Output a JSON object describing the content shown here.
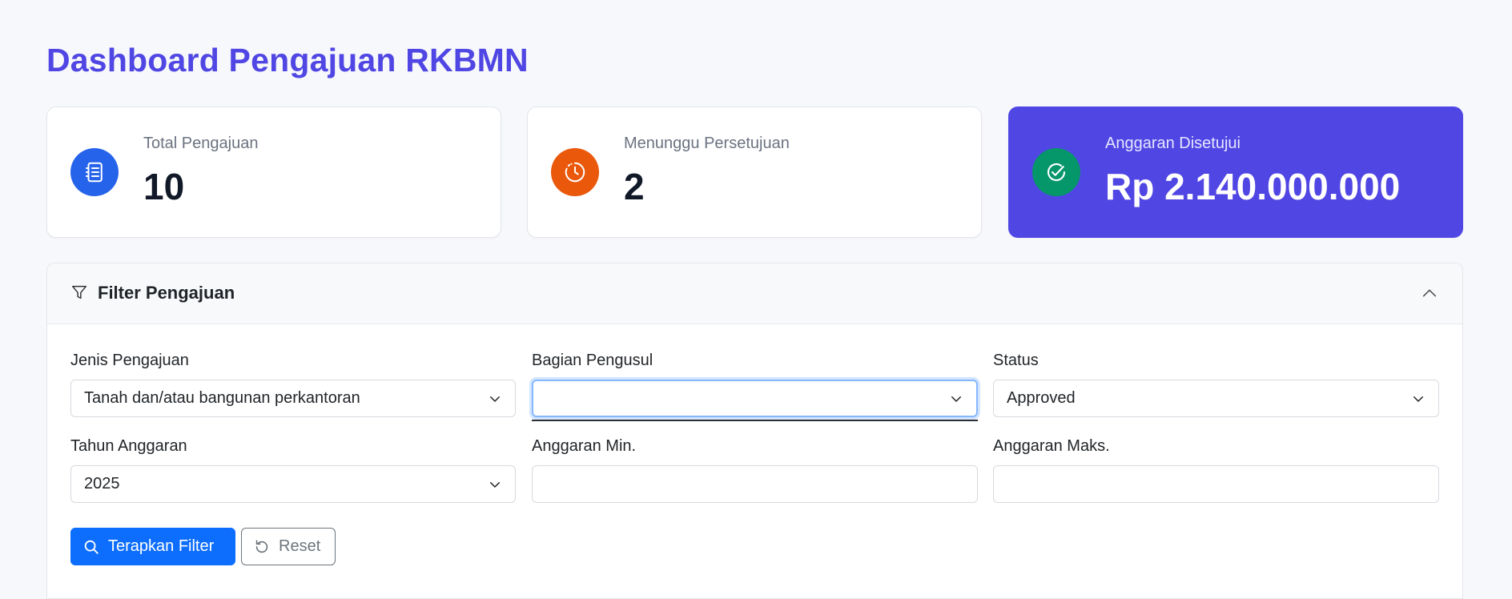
{
  "page": {
    "title": "Dashboard Pengajuan RKBMN"
  },
  "stats": [
    {
      "label": "Total Pengajuan",
      "value": "10",
      "icon": "document-list-icon",
      "icon_color": "#2563eb"
    },
    {
      "label": "Menunggu Persetujuan",
      "value": "2",
      "icon": "clock-icon",
      "icon_color": "#ea580c"
    },
    {
      "label": "Anggaran Disetujui",
      "value": "Rp 2.140.000.000",
      "icon": "check-circle-icon",
      "icon_color": "#059669",
      "card_color": "#5046e4"
    }
  ],
  "filter": {
    "title": "Filter Pengajuan",
    "fields": {
      "jenis": {
        "label": "Jenis Pengajuan",
        "value": "Tanah dan/atau bangunan perkantoran"
      },
      "bagian": {
        "label": "Bagian Pengusul",
        "value": ""
      },
      "status": {
        "label": "Status",
        "value": "Approved"
      },
      "tahun": {
        "label": "Tahun Anggaran",
        "value": "2025"
      },
      "min": {
        "label": "Anggaran Min.",
        "value": ""
      },
      "maks": {
        "label": "Anggaran Maks.",
        "value": ""
      }
    },
    "buttons": {
      "apply": "Terapkan Filter",
      "reset": "Reset"
    }
  },
  "colors": {
    "accent": "#5046e4",
    "primary_button": "#0d6efd",
    "focus_ring": "#86b7fe"
  }
}
